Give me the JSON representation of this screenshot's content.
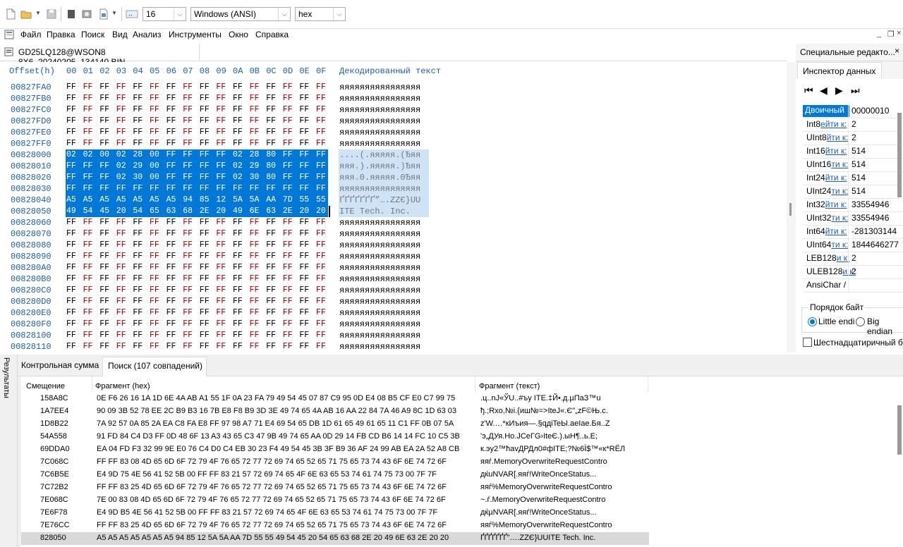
{
  "toolbar": {
    "bytes_per_row": "16",
    "encoding": "Windows (ANSI)",
    "mode": "hex",
    "icons": [
      "new-file-icon",
      "open-folder-icon",
      "save-icon",
      "hex-editor-icon",
      "disk-icon",
      "export-icon",
      "arrows-icon"
    ]
  },
  "menu": [
    "Файл",
    "Правка",
    "Поиск",
    "Вид",
    "Анализ",
    "Инструменты",
    "Окно",
    "Справка"
  ],
  "file_tab": "GD25LQ128@WSON8 8X6_20240205_134140.BIN",
  "hex": {
    "header_offset": "Offset(h)",
    "header_cols": [
      "00",
      "01",
      "02",
      "03",
      "04",
      "05",
      "06",
      "07",
      "08",
      "09",
      "0A",
      "0B",
      "0C",
      "0D",
      "0E",
      "0F"
    ],
    "header_decoded": "Декодированный текст",
    "rows": [
      {
        "offset": "00827FA0",
        "bytes": [
          "FF",
          "FF",
          "FF",
          "FF",
          "FF",
          "FF",
          "FF",
          "FF",
          "FF",
          "FF",
          "FF",
          "FF",
          "FF",
          "FF",
          "FF",
          "FF"
        ],
        "ascii": "яяяяяяяяяяяяяяяя",
        "sel": false
      },
      {
        "offset": "00827FB0",
        "bytes": [
          "FF",
          "FF",
          "FF",
          "FF",
          "FF",
          "FF",
          "FF",
          "FF",
          "FF",
          "FF",
          "FF",
          "FF",
          "FF",
          "FF",
          "FF",
          "FF"
        ],
        "ascii": "яяяяяяяяяяяяяяяя",
        "sel": false
      },
      {
        "offset": "00827FC0",
        "bytes": [
          "FF",
          "FF",
          "FF",
          "FF",
          "FF",
          "FF",
          "FF",
          "FF",
          "FF",
          "FF",
          "FF",
          "FF",
          "FF",
          "FF",
          "FF",
          "FF"
        ],
        "ascii": "яяяяяяяяяяяяяяяя",
        "sel": false
      },
      {
        "offset": "00827FD0",
        "bytes": [
          "FF",
          "FF",
          "FF",
          "FF",
          "FF",
          "FF",
          "FF",
          "FF",
          "FF",
          "FF",
          "FF",
          "FF",
          "FF",
          "FF",
          "FF",
          "FF"
        ],
        "ascii": "яяяяяяяяяяяяяяяя",
        "sel": false
      },
      {
        "offset": "00827FE0",
        "bytes": [
          "FF",
          "FF",
          "FF",
          "FF",
          "FF",
          "FF",
          "FF",
          "FF",
          "FF",
          "FF",
          "FF",
          "FF",
          "FF",
          "FF",
          "FF",
          "FF"
        ],
        "ascii": "яяяяяяяяяяяяяяяя",
        "sel": false
      },
      {
        "offset": "00827FF0",
        "bytes": [
          "FF",
          "FF",
          "FF",
          "FF",
          "FF",
          "FF",
          "FF",
          "FF",
          "FF",
          "FF",
          "FF",
          "FF",
          "FF",
          "FF",
          "FF",
          "FF"
        ],
        "ascii": "яяяяяяяяяяяяяяяя",
        "sel": false
      },
      {
        "offset": "00828000",
        "bytes": [
          "02",
          "02",
          "00",
          "02",
          "28",
          "00",
          "FF",
          "FF",
          "FF",
          "FF",
          "02",
          "28",
          "80",
          "FF",
          "FF",
          "FF"
        ],
        "ascii": "....(.яяяяя.(Ђяя",
        "sel": true
      },
      {
        "offset": "00828010",
        "bytes": [
          "FF",
          "FF",
          "FF",
          "02",
          "29",
          "00",
          "FF",
          "FF",
          "FF",
          "FF",
          "02",
          "29",
          "80",
          "FF",
          "FF",
          "FF"
        ],
        "ascii": "яяя.).яяяяя.)Ђяя",
        "sel": true
      },
      {
        "offset": "00828020",
        "bytes": [
          "FF",
          "FF",
          "FF",
          "02",
          "30",
          "00",
          "FF",
          "FF",
          "FF",
          "FF",
          "02",
          "30",
          "80",
          "FF",
          "FF",
          "FF"
        ],
        "ascii": "яяя.0.яяяяя.0Ђяя",
        "sel": true
      },
      {
        "offset": "00828030",
        "bytes": [
          "FF",
          "FF",
          "FF",
          "FF",
          "FF",
          "FF",
          "FF",
          "FF",
          "FF",
          "FF",
          "FF",
          "FF",
          "FF",
          "FF",
          "FF",
          "FF"
        ],
        "ascii": "яяяяяяяяяяяяяяяя",
        "sel": true
      },
      {
        "offset": "00828040",
        "bytes": [
          "A5",
          "A5",
          "A5",
          "A5",
          "A5",
          "A5",
          "A5",
          "94",
          "85",
          "12",
          "5A",
          "5A",
          "AA",
          "7D",
          "55",
          "55"
        ],
        "ascii": "ҐҐҐҐҐҐҐ”….ZZЄ}UU",
        "sel": true
      },
      {
        "offset": "00828050",
        "bytes": [
          "49",
          "54",
          "45",
          "20",
          "54",
          "65",
          "63",
          "68",
          "2E",
          "20",
          "49",
          "6E",
          "63",
          "2E",
          "20",
          "20"
        ],
        "ascii": "ITE Tech. Inc.  ",
        "sel": true
      },
      {
        "offset": "00828060",
        "bytes": [
          "FF",
          "FF",
          "FF",
          "FF",
          "FF",
          "FF",
          "FF",
          "FF",
          "FF",
          "FF",
          "FF",
          "FF",
          "FF",
          "FF",
          "FF",
          "FF"
        ],
        "ascii": "яяяяяяяяяяяяяяяя",
        "sel": false
      },
      {
        "offset": "00828070",
        "bytes": [
          "FF",
          "FF",
          "FF",
          "FF",
          "FF",
          "FF",
          "FF",
          "FF",
          "FF",
          "FF",
          "FF",
          "FF",
          "FF",
          "FF",
          "FF",
          "FF"
        ],
        "ascii": "яяяяяяяяяяяяяяяя",
        "sel": false
      },
      {
        "offset": "00828080",
        "bytes": [
          "FF",
          "FF",
          "FF",
          "FF",
          "FF",
          "FF",
          "FF",
          "FF",
          "FF",
          "FF",
          "FF",
          "FF",
          "FF",
          "FF",
          "FF",
          "FF"
        ],
        "ascii": "яяяяяяяяяяяяяяяя",
        "sel": false
      },
      {
        "offset": "00828090",
        "bytes": [
          "FF",
          "FF",
          "FF",
          "FF",
          "FF",
          "FF",
          "FF",
          "FF",
          "FF",
          "FF",
          "FF",
          "FF",
          "FF",
          "FF",
          "FF",
          "FF"
        ],
        "ascii": "яяяяяяяяяяяяяяяя",
        "sel": false
      },
      {
        "offset": "008280A0",
        "bytes": [
          "FF",
          "FF",
          "FF",
          "FF",
          "FF",
          "FF",
          "FF",
          "FF",
          "FF",
          "FF",
          "FF",
          "FF",
          "FF",
          "FF",
          "FF",
          "FF"
        ],
        "ascii": "яяяяяяяяяяяяяяяя",
        "sel": false
      },
      {
        "offset": "008280B0",
        "bytes": [
          "FF",
          "FF",
          "FF",
          "FF",
          "FF",
          "FF",
          "FF",
          "FF",
          "FF",
          "FF",
          "FF",
          "FF",
          "FF",
          "FF",
          "FF",
          "FF"
        ],
        "ascii": "яяяяяяяяяяяяяяяя",
        "sel": false
      },
      {
        "offset": "008280C0",
        "bytes": [
          "FF",
          "FF",
          "FF",
          "FF",
          "FF",
          "FF",
          "FF",
          "FF",
          "FF",
          "FF",
          "FF",
          "FF",
          "FF",
          "FF",
          "FF",
          "FF"
        ],
        "ascii": "яяяяяяяяяяяяяяяя",
        "sel": false
      },
      {
        "offset": "008280D0",
        "bytes": [
          "FF",
          "FF",
          "FF",
          "FF",
          "FF",
          "FF",
          "FF",
          "FF",
          "FF",
          "FF",
          "FF",
          "FF",
          "FF",
          "FF",
          "FF",
          "FF"
        ],
        "ascii": "яяяяяяяяяяяяяяяя",
        "sel": false
      },
      {
        "offset": "008280E0",
        "bytes": [
          "FF",
          "FF",
          "FF",
          "FF",
          "FF",
          "FF",
          "FF",
          "FF",
          "FF",
          "FF",
          "FF",
          "FF",
          "FF",
          "FF",
          "FF",
          "FF"
        ],
        "ascii": "яяяяяяяяяяяяяяяя",
        "sel": false
      },
      {
        "offset": "008280F0",
        "bytes": [
          "FF",
          "FF",
          "FF",
          "FF",
          "FF",
          "FF",
          "FF",
          "FF",
          "FF",
          "FF",
          "FF",
          "FF",
          "FF",
          "FF",
          "FF",
          "FF"
        ],
        "ascii": "яяяяяяяяяяяяяяяя",
        "sel": false
      },
      {
        "offset": "00828100",
        "bytes": [
          "FF",
          "FF",
          "FF",
          "FF",
          "FF",
          "FF",
          "FF",
          "FF",
          "FF",
          "FF",
          "FF",
          "FF",
          "FF",
          "FF",
          "FF",
          "FF"
        ],
        "ascii": "яяяяяяяяяяяяяяяя",
        "sel": false
      },
      {
        "offset": "00828110",
        "bytes": [
          "FF",
          "FF",
          "FF",
          "FF",
          "FF",
          "FF",
          "FF",
          "FF",
          "FF",
          "FF",
          "FF",
          "FF",
          "FF",
          "FF",
          "FF",
          "FF"
        ],
        "ascii": "яяяяяяяяяяяяяяяя",
        "sel": false
      }
    ]
  },
  "inspector": {
    "panel_tab": "Специальные редакто...",
    "title": "Инспектор данных",
    "rows": [
      {
        "label": "Двоичный",
        "link": "",
        "value": "00000010",
        "highlight": true
      },
      {
        "label": "Int8",
        "link": "ейти к:",
        "value": "2"
      },
      {
        "label": "UInt8",
        "link": "йти к:",
        "value": "2"
      },
      {
        "label": "Int16",
        "link": "йти к:",
        "value": "514"
      },
      {
        "label": "UInt16",
        "link": "ти к:",
        "value": "514"
      },
      {
        "label": "Int24",
        "link": "йти к:",
        "value": "514"
      },
      {
        "label": "UInt24",
        "link": "ти к:",
        "value": "514"
      },
      {
        "label": "Int32",
        "link": "йти к:",
        "value": "33554946"
      },
      {
        "label": "UInt32",
        "link": "ти к:",
        "value": "33554946"
      },
      {
        "label": "Int64",
        "link": "йти к:",
        "value": "-281303144"
      },
      {
        "label": "UInt64",
        "link": "ти к:",
        "value": "1844646277"
      },
      {
        "label": "LEB128",
        "link": "и к:",
        "value": "2"
      },
      {
        "label": "ULEB128",
        "link": "и к:",
        "value": "2"
      },
      {
        "label": "AnsiChar /",
        "link": "",
        "value": ""
      }
    ],
    "byte_order_label": "Порядок байт",
    "little_endian": "Little endi",
    "big_endian": "Big endian",
    "hex_checkbox": "Шестнадцатиричный ба"
  },
  "bottom": {
    "side_label": "Результаты",
    "tab_checksum": "Контрольная сумма",
    "tab_search": "Поиск (107 совпадений)",
    "col_offset": "Смещение",
    "col_hex": "Фрагмент (hex)",
    "col_text": "Фрагмент (текст)",
    "rows": [
      {
        "off": "158A8C",
        "hex": "0E F6 26 16 1A 1D 6E 4A AB A1 55 1F 0A 23 FA 79 49 54 45 07 87 C9 95 0D E4 08 B5 CF E0 C7 99 75",
        "txt": ".ц..nJ«ЎU..#ъy ITE.‡Й•.д.µПаЗ™u"
      },
      {
        "off": "1A7EE4",
        "hex": "90 09 3B 52 78 EE 2C B9 B3 16 7B E8 F8 B9 3D 3E 49 74 65 4A AB 16 AA 22 84 7A 46 A9 8C 1D 63 03",
        "txt": "ђ.;Rxо,№і.{иш№=>IteJ«.Є\"„zF©Њ.c."
      },
      {
        "off": "1D8B22",
        "hex": "7A 92 57 0A 85 2A EA C8 FA E8 FF 97 98 A7 71 E4 69 54 65 DB 1D 61 65 49 61 65 11 C1 FF 0B 07 5A",
        "txt": "z'W.…*кИъия—.§qдiTeЫ.aeIae.Бя..Z"
      },
      {
        "off": "54A558",
        "hex": "91 FD 84 C4 D3 FF 0D 48 6F 13 A3 43 65 C3 47 9B 49 74 65 AA 0D 29 14 FB CD B6 14 14 FC 10 C5 3B",
        "txt": "'э„ДУя.Ho.ЈCeГG›IteЄ.).ыН¶..ь.Е;"
      },
      {
        "off": "69DDA0",
        "hex": "EA 04 FD F3 32 99 9E E0 76 C4 D0 C4 EB 30 23 F4 49 54 45 3B 3F B9 36 AF 24 99 AB EA 2A 52 A8 CB",
        "txt": "к.эу2™ћavДРДл0#фITE;?№6Ї$™«к*RЁЛ"
      },
      {
        "off": "7C068C",
        "hex": "FF FF 83 08 4D 65 6D 6F 72 79 4F 76 65 72 77 72 69 74 65 52 65 71 75 65 73 74 43 6F 6E 74 72 6F",
        "txt": "яяѓ.MemoryOverwriteRequestContro"
      },
      {
        "off": "7C6B5E",
        "hex": "E4 9D 75 4E 56 41 52 5B 00 FF FF 83 21 57 72 69 74 65 4F 6E 63 65 53 74 61 74 75 73 00 7F 7F",
        "txt": "дќuNVAR[.яяѓ!WriteOnceStatus..."
      },
      {
        "off": "7C72B2",
        "hex": "FF FF 83 25 4D 65 6D 6F 72 79 4F 76 65 72 77 72 69 74 65 52 65 71 75 65 73 74 43 6F 6E 74 72 6F",
        "txt": "яяѓ%MemoryOverwriteRequestContro"
      },
      {
        "off": "7E068C",
        "hex": "7E 00 83 08 4D 65 6D 6F 72 79 4F 76 65 72 77 72 69 74 65 52 65 71 75 65 73 74 43 6F 6E 74 72 6F",
        "txt": "~.ѓ.MemoryOverwriteRequestContro"
      },
      {
        "off": "7E6F78",
        "hex": "E4 9D B5 4E 56 41 52 5B 00 FF FF 83 21 57 72 69 74 65 4F 6E 63 65 53 74 61 74 75 73 00 7F 7F",
        "txt": "дќµNVAR[.яяѓ!WriteOnceStatus..."
      },
      {
        "off": "7E76CC",
        "hex": "FF FF 83 25 4D 65 6D 6F 72 79 4F 76 65 72 77 72 69 74 65 52 65 71 75 65 73 74 43 6F 6E 74 72 6F",
        "txt": "яяѓ%MemoryOverwriteRequestContro"
      },
      {
        "off": "828050",
        "hex": "A5 A5 A5 A5 A5 A5 A5 94 85 12 5A 5A AA 7D 55 55 49 54 45 20 54 65 63 68 2E 20 49 6E 63 2E 20 20",
        "txt": "ҐҐҐҐҐҐҐ”….ZZЄ}UUITE Tech. Inc.",
        "selected": true
      }
    ]
  },
  "colors": {
    "accent": "#0078d7",
    "offset_blue": "#1a5fb4",
    "byte_red": "#b00000"
  }
}
